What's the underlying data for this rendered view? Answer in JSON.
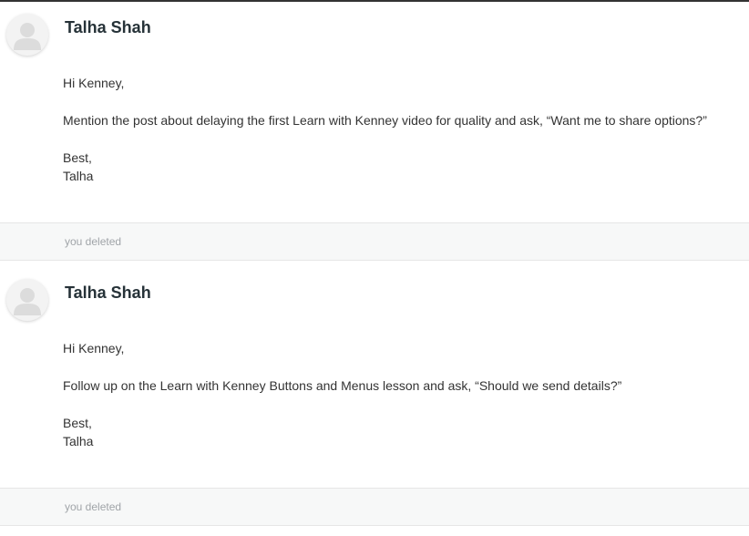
{
  "messages": [
    {
      "sender": "Talha Shah",
      "greeting": "Hi Kenney,",
      "body": "Mention the post about delaying the first Learn with Kenney video for quality and ask, “Want me to share options?”",
      "signoff": "Best,",
      "signature": "Talha",
      "status": "you deleted"
    },
    {
      "sender": "Talha Shah",
      "greeting": "Hi Kenney,",
      "body": "Follow up on the Learn with Kenney Buttons and Menus lesson and ask, “Should we send details?”",
      "signoff": "Best,",
      "signature": "Talha",
      "status": "you deleted"
    }
  ],
  "icons": {
    "avatar": "default-user-avatar-icon"
  }
}
